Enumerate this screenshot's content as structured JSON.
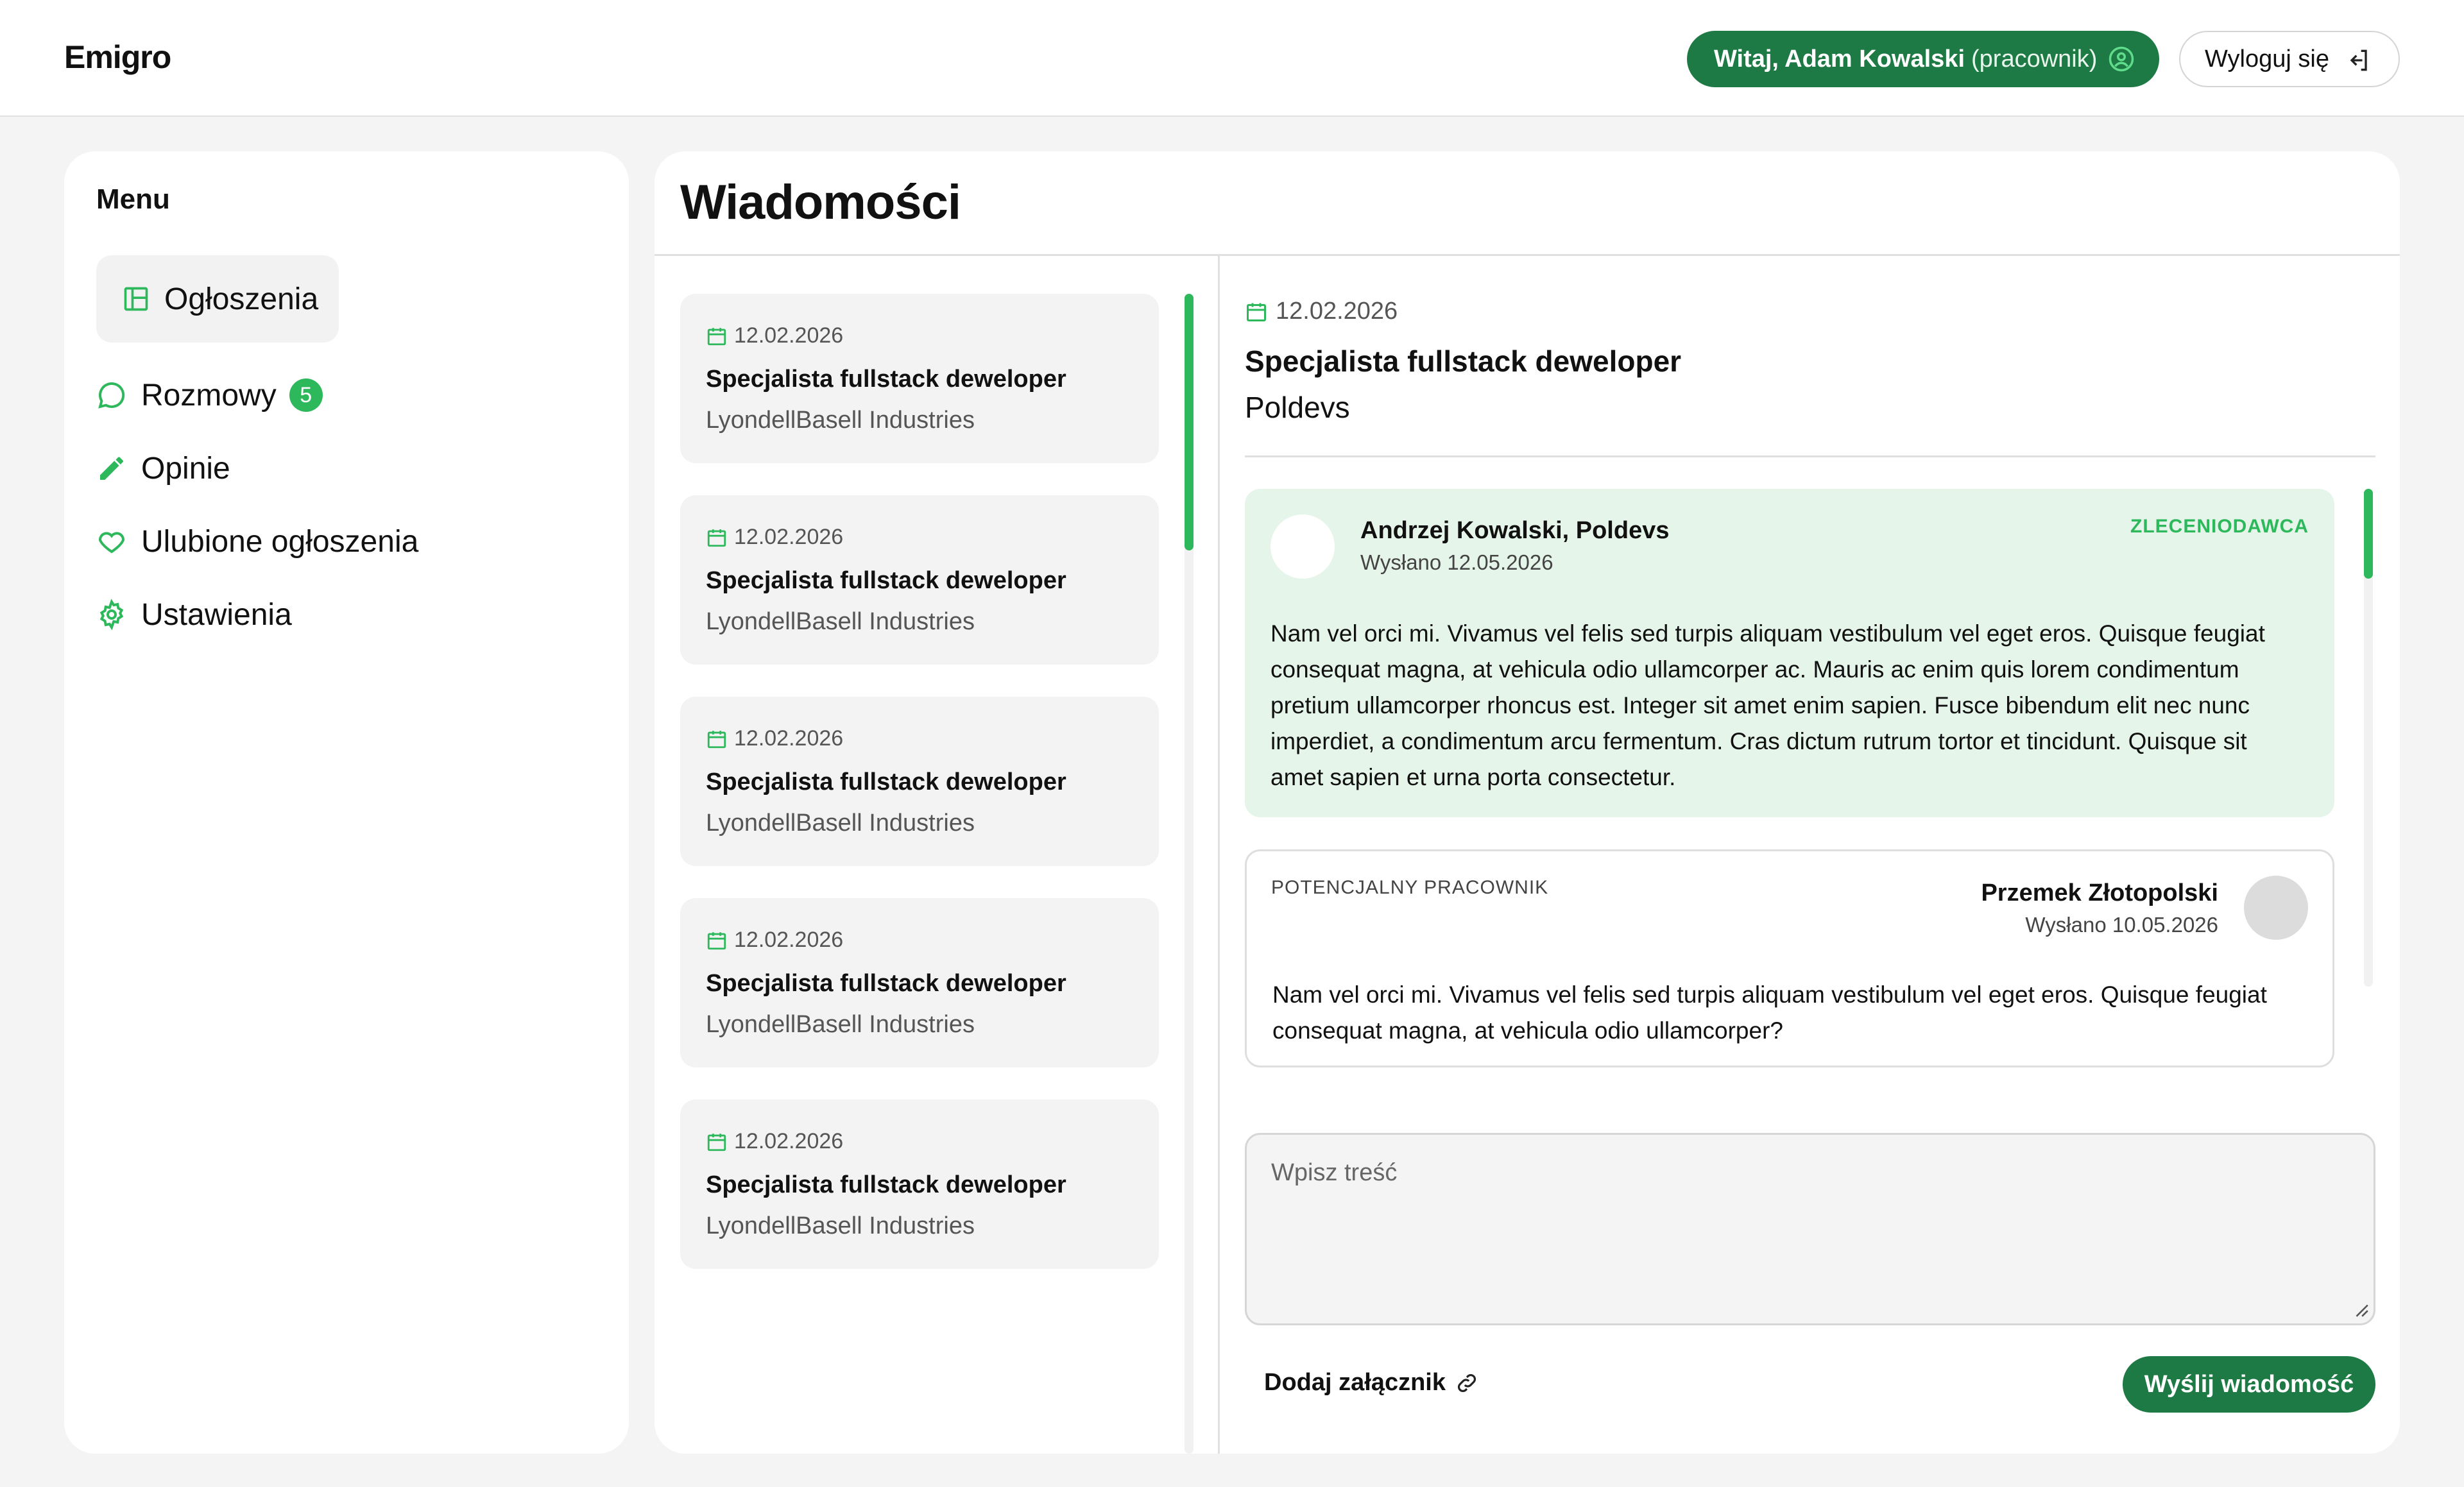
{
  "app": {
    "logo": "Emigro"
  },
  "header": {
    "welcome_bold": "Witaj, Adam Kowalski",
    "welcome_role": "(pracownik)",
    "logout_label": "Wyloguj się"
  },
  "sidebar": {
    "title": "Menu",
    "items": [
      {
        "label": "Ogłoszenia",
        "icon": "layout-icon",
        "active": true
      },
      {
        "label": "Rozmowy",
        "icon": "chat-bubble-icon",
        "badge": "5"
      },
      {
        "label": "Opinie",
        "icon": "pencil-icon"
      },
      {
        "label": "Ulubione ogłoszenia",
        "icon": "heart-icon"
      },
      {
        "label": "Ustawienia",
        "icon": "gear-icon"
      }
    ]
  },
  "main": {
    "title": "Wiadomości",
    "conversations": [
      {
        "date": "12.02.2026",
        "title": "Specjalista fullstack deweloper",
        "company": "LyondellBasell Industries"
      },
      {
        "date": "12.02.2026",
        "title": "Specjalista fullstack deweloper",
        "company": "LyondellBasell Industries"
      },
      {
        "date": "12.02.2026",
        "title": "Specjalista fullstack deweloper",
        "company": "LyondellBasell Industries"
      },
      {
        "date": "12.02.2026",
        "title": "Specjalista fullstack deweloper",
        "company": "LyondellBasell Industries"
      },
      {
        "date": "12.02.2026",
        "title": "Specjalista fullstack deweloper",
        "company": "LyondellBasell Industries"
      }
    ],
    "detail": {
      "date": "12.02.2026",
      "title": "Specjalista fullstack deweloper",
      "company": "Poldevs",
      "messages": [
        {
          "role": "ZLECENIODAWCA",
          "sender": "Andrzej Kowalski, Poldevs",
          "sent": "Wysłano 12.05.2026",
          "body": "Nam vel orci mi. Vivamus vel felis sed turpis aliquam vestibulum vel eget eros. Quisque feugiat consequat magna, at vehicula odio ullamcorper ac. Mauris ac enim quis lorem condimentum pretium ullamcorper rhoncus est. Integer sit amet enim sapien. Fusce bibendum elit nec nunc imperdiet, a condimentum arcu fermentum. Cras dictum rutrum tortor et tincidunt. Quisque sit amet sapien et urna porta consectetur."
        },
        {
          "role": "POTENCJALNY PRACOWNIK",
          "sender": "Przemek Złotopolski",
          "sent": "Wysłano 10.05.2026",
          "body": "Nam vel orci mi. Vivamus vel felis sed turpis aliquam vestibulum vel eget eros. Quisque feugiat consequat magna, at vehicula odio ullamcorper?"
        }
      ],
      "compose_placeholder": "Wpisz treść",
      "compose_value": "",
      "attach_label": "Dodaj załącznik",
      "send_label": "Wyślij wiadomość"
    }
  },
  "colors": {
    "brand_green": "#1e7a45",
    "accent_green": "#2eb85c",
    "employer_bubble": "#e6f5ea"
  }
}
